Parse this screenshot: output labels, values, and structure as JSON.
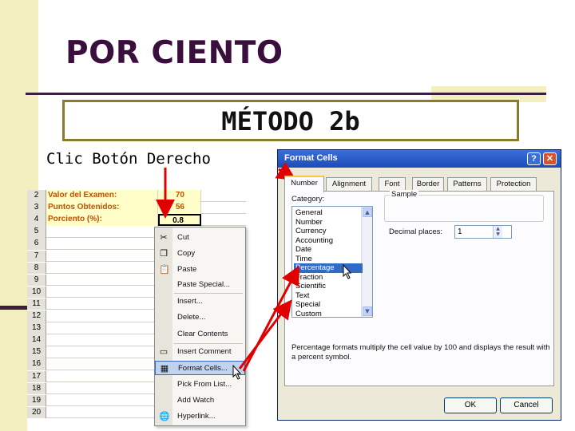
{
  "slide": {
    "title": "POR CIENTO",
    "method": "MÉTODO 2b",
    "subtitle": "Clic Botón Derecho"
  },
  "sheet": {
    "rows": [
      {
        "num": "2",
        "label": "Valor del Examen:",
        "value": "70"
      },
      {
        "num": "3",
        "label": "Puntos Obtenidos:",
        "value": "56"
      },
      {
        "num": "4",
        "label": "Porciento (%):",
        "value": "0.8"
      },
      {
        "num": "5",
        "label": "",
        "value": ""
      },
      {
        "num": "6",
        "label": "",
        "value": ""
      },
      {
        "num": "7",
        "label": "",
        "value": ""
      },
      {
        "num": "8",
        "label": "",
        "value": ""
      },
      {
        "num": "9",
        "label": "",
        "value": ""
      },
      {
        "num": "10",
        "label": "",
        "value": ""
      },
      {
        "num": "11",
        "label": "",
        "value": ""
      },
      {
        "num": "12",
        "label": "",
        "value": ""
      },
      {
        "num": "13",
        "label": "",
        "value": ""
      },
      {
        "num": "14",
        "label": "",
        "value": ""
      },
      {
        "num": "15",
        "label": "",
        "value": ""
      },
      {
        "num": "16",
        "label": "",
        "value": ""
      },
      {
        "num": "17",
        "label": "",
        "value": ""
      },
      {
        "num": "18",
        "label": "",
        "value": ""
      },
      {
        "num": "19",
        "label": "",
        "value": ""
      },
      {
        "num": "20",
        "label": "",
        "value": ""
      }
    ]
  },
  "context_menu": {
    "items": [
      {
        "label": "Cut",
        "icon": "scissors-icon",
        "glyph": "✂"
      },
      {
        "label": "Copy",
        "icon": "copy-icon",
        "glyph": "❐"
      },
      {
        "label": "Paste",
        "icon": "paste-icon",
        "glyph": "📋"
      },
      {
        "label": "Paste Special...",
        "icon": "",
        "glyph": ""
      },
      {
        "label": "Insert...",
        "icon": "",
        "glyph": ""
      },
      {
        "label": "Delete...",
        "icon": "",
        "glyph": ""
      },
      {
        "label": "Clear Contents",
        "icon": "",
        "glyph": ""
      },
      {
        "label": "Insert Comment",
        "icon": "comment-icon",
        "glyph": "▭"
      },
      {
        "label": "Format Cells...",
        "icon": "format-cells-icon",
        "glyph": "▦"
      },
      {
        "label": "Pick From List...",
        "icon": "",
        "glyph": ""
      },
      {
        "label": "Add Watch",
        "icon": "",
        "glyph": ""
      },
      {
        "label": "Hyperlink...",
        "icon": "hyperlink-icon",
        "glyph": "🌐"
      }
    ]
  },
  "dialog": {
    "title": "Format Cells",
    "help_glyph": "?",
    "close_glyph": "✕",
    "tabs": [
      "Number",
      "Alignment",
      "Font",
      "Border",
      "Patterns",
      "Protection"
    ],
    "category_label": "Category:",
    "categories": [
      "General",
      "Number",
      "Currency",
      "Accounting",
      "Date",
      "Time",
      "Percentage",
      "Fraction",
      "Scientific",
      "Text",
      "Special",
      "Custom"
    ],
    "selected_category": "Percentage",
    "sample_label": "Sample",
    "decimal_label": "Decimal places:",
    "decimal_value": "1",
    "description": "Percentage formats multiply the cell value by 100 and displays the result with a percent symbol.",
    "ok_label": "OK",
    "cancel_label": "Cancel"
  },
  "colors": {
    "title": "#3a0f3d",
    "accent_bar": "#f3efc1",
    "arrow": "#e00000",
    "selection": "#316ac5"
  }
}
